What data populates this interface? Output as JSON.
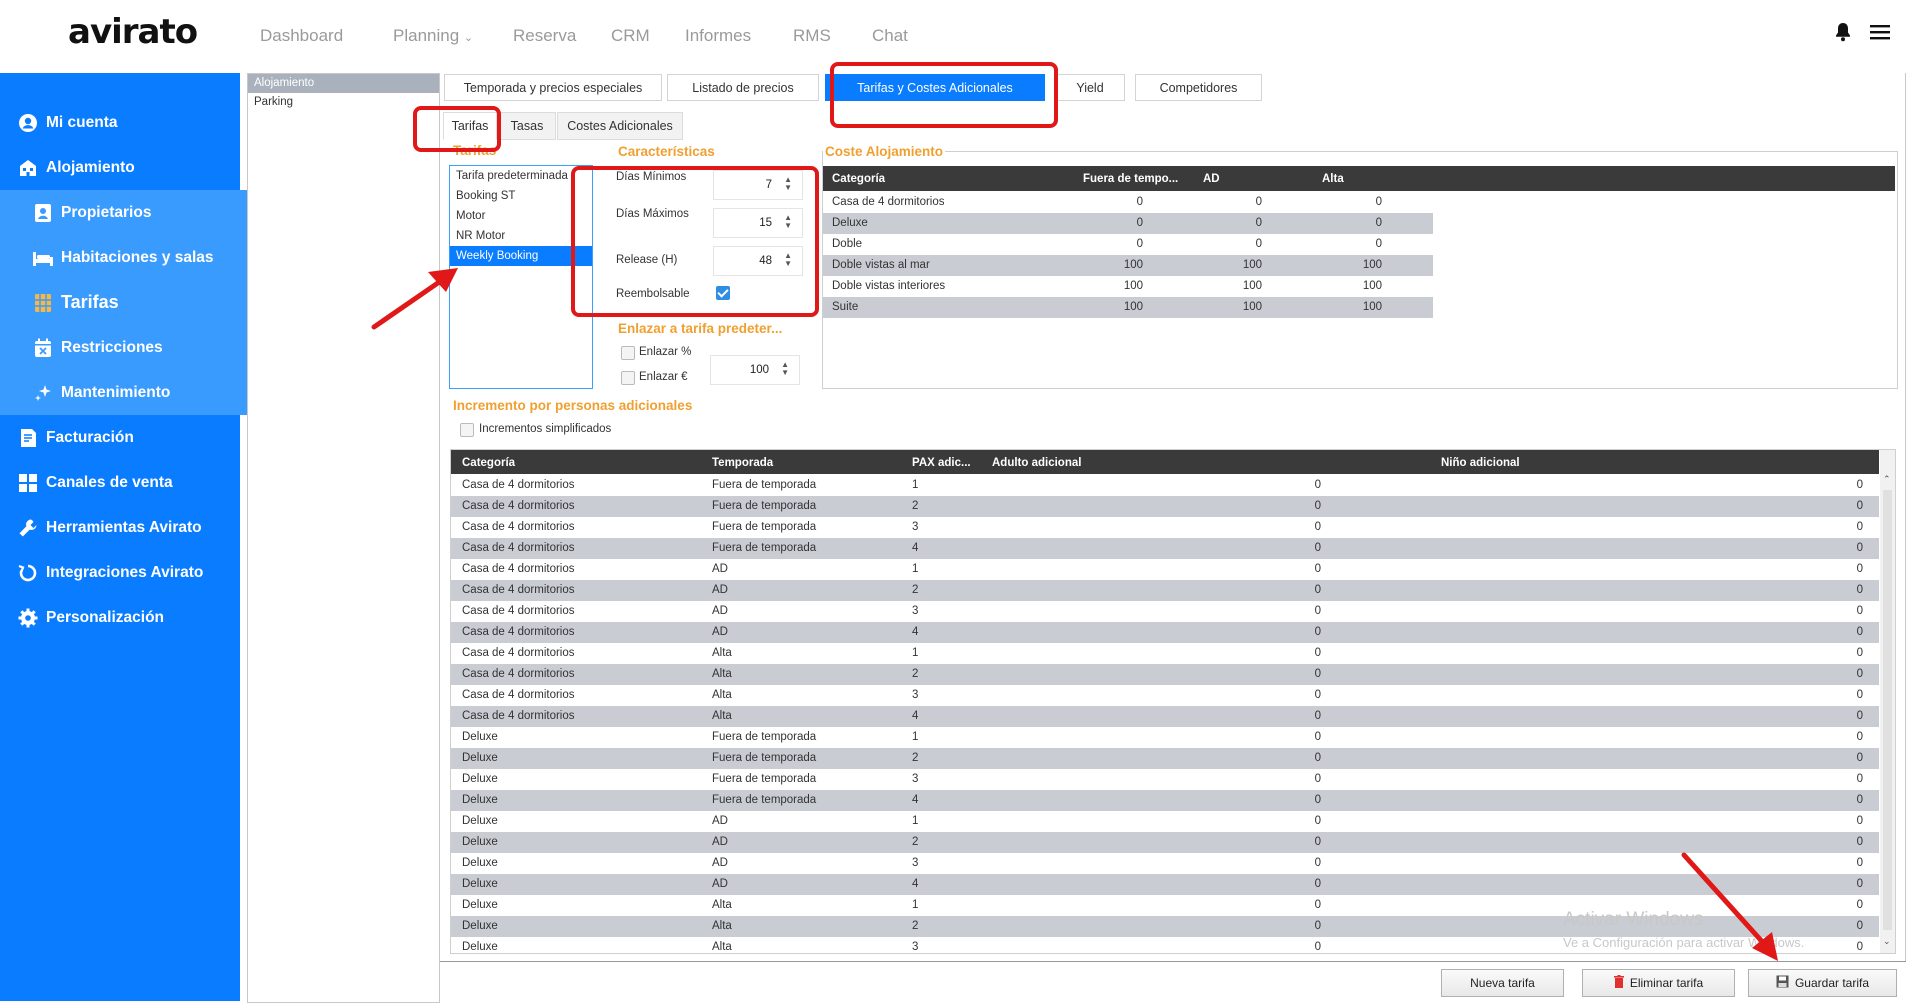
{
  "logo": "avirato",
  "nav": [
    "Dashboard",
    "Planning",
    "Reserva",
    "CRM",
    "Informes",
    "RMS",
    "Chat"
  ],
  "sidebar": {
    "items": [
      {
        "label": "Mi cuenta",
        "icon": "user-circle-icon"
      },
      {
        "label": "Alojamiento",
        "icon": "building-icon"
      },
      {
        "label": "Propietarios",
        "icon": "owner-icon"
      },
      {
        "label": "Habitaciones y salas",
        "icon": "bed-icon"
      },
      {
        "label": "Tarifas",
        "icon": "grid-icon"
      },
      {
        "label": "Restricciones",
        "icon": "calendar-x-icon"
      },
      {
        "label": "Mantenimiento",
        "icon": "sparkle-icon"
      },
      {
        "label": "Facturación",
        "icon": "invoice-icon"
      },
      {
        "label": "Canales de venta",
        "icon": "channels-icon"
      },
      {
        "label": "Herramientas Avirato",
        "icon": "wrench-icon"
      },
      {
        "label": "Integraciones Avirato",
        "icon": "integration-icon"
      },
      {
        "label": "Personalización",
        "icon": "gear-icon"
      }
    ]
  },
  "properties": [
    "Alojamiento",
    "Parking"
  ],
  "top_tabs": [
    "Temporada y precios especiales",
    "Listado de precios",
    "Tarifas y  Costes Adicionales",
    "Yield",
    "Competidores"
  ],
  "sub_tabs": [
    "Tarifas",
    "Tasas",
    "Costes Adicionales"
  ],
  "rates": {
    "title": "Tarifas",
    "items": [
      "Tarifa predeterminada",
      "Booking ST",
      "Motor",
      "NR Motor",
      "Weekly Booking"
    ],
    "selected": "Weekly Booking"
  },
  "characteristics": {
    "title": "Características",
    "dias_minimos_label": "Días Mínimos",
    "dias_minimos": "7",
    "dias_maximos_label": "Días Máximos",
    "dias_maximos": "15",
    "release_label": "Release (H)",
    "release": "48",
    "reembolsable_label": "Reembolsable",
    "reembolsable": true
  },
  "link_rate": {
    "title": "Enlazar a tarifa predeter...",
    "pct_label": "Enlazar %",
    "eur_label": "Enlazar €",
    "value": "100"
  },
  "coste_alojamiento": {
    "title": "Coste Alojamiento",
    "headers": [
      "Categoría",
      "Fuera de tempo...",
      "AD",
      "Alta"
    ],
    "rows": [
      [
        "Casa de 4 dormitorios",
        "0",
        "0",
        "0"
      ],
      [
        "Deluxe",
        "0",
        "0",
        "0"
      ],
      [
        "Doble",
        "0",
        "0",
        "0"
      ],
      [
        "Doble vistas al mar",
        "100",
        "100",
        "100"
      ],
      [
        "Doble vistas interiores",
        "100",
        "100",
        "100"
      ],
      [
        "Suite",
        "100",
        "100",
        "100"
      ]
    ]
  },
  "incremento": {
    "title": "Incremento por personas adicionales",
    "simplificados_label": "Incrementos simplificados",
    "headers": [
      "Categoría",
      "Temporada",
      "PAX adic...",
      "Adulto adicional",
      "Niño adicional"
    ],
    "rows": [
      [
        "Casa de 4 dormitorios",
        "Fuera de temporada",
        "1",
        "0",
        "0"
      ],
      [
        "Casa de 4 dormitorios",
        "Fuera de temporada",
        "2",
        "0",
        "0"
      ],
      [
        "Casa de 4 dormitorios",
        "Fuera de temporada",
        "3",
        "0",
        "0"
      ],
      [
        "Casa de 4 dormitorios",
        "Fuera de temporada",
        "4",
        "0",
        "0"
      ],
      [
        "Casa de 4 dormitorios",
        "AD",
        "1",
        "0",
        "0"
      ],
      [
        "Casa de 4 dormitorios",
        "AD",
        "2",
        "0",
        "0"
      ],
      [
        "Casa de 4 dormitorios",
        "AD",
        "3",
        "0",
        "0"
      ],
      [
        "Casa de 4 dormitorios",
        "AD",
        "4",
        "0",
        "0"
      ],
      [
        "Casa de 4 dormitorios",
        "Alta",
        "1",
        "0",
        "0"
      ],
      [
        "Casa de 4 dormitorios",
        "Alta",
        "2",
        "0",
        "0"
      ],
      [
        "Casa de 4 dormitorios",
        "Alta",
        "3",
        "0",
        "0"
      ],
      [
        "Casa de 4 dormitorios",
        "Alta",
        "4",
        "0",
        "0"
      ],
      [
        "Deluxe",
        "Fuera de temporada",
        "1",
        "0",
        "0"
      ],
      [
        "Deluxe",
        "Fuera de temporada",
        "2",
        "0",
        "0"
      ],
      [
        "Deluxe",
        "Fuera de temporada",
        "3",
        "0",
        "0"
      ],
      [
        "Deluxe",
        "Fuera de temporada",
        "4",
        "0",
        "0"
      ],
      [
        "Deluxe",
        "AD",
        "1",
        "0",
        "0"
      ],
      [
        "Deluxe",
        "AD",
        "2",
        "0",
        "0"
      ],
      [
        "Deluxe",
        "AD",
        "3",
        "0",
        "0"
      ],
      [
        "Deluxe",
        "AD",
        "4",
        "0",
        "0"
      ],
      [
        "Deluxe",
        "Alta",
        "1",
        "0",
        "0"
      ],
      [
        "Deluxe",
        "Alta",
        "2",
        "0",
        "0"
      ],
      [
        "Deluxe",
        "Alta",
        "3",
        "0",
        "0"
      ]
    ]
  },
  "buttons": {
    "nueva": "Nueva tarifa",
    "eliminar": "Eliminar tarifa",
    "guardar": "Guardar tarifa"
  },
  "watermark": {
    "line1": "Activar Windows",
    "line2": "Ve a Configuración para activar Windows."
  },
  "colors": {
    "accent": "#0a7cff",
    "section_title": "#f0a030",
    "annotation": "#e01818"
  }
}
